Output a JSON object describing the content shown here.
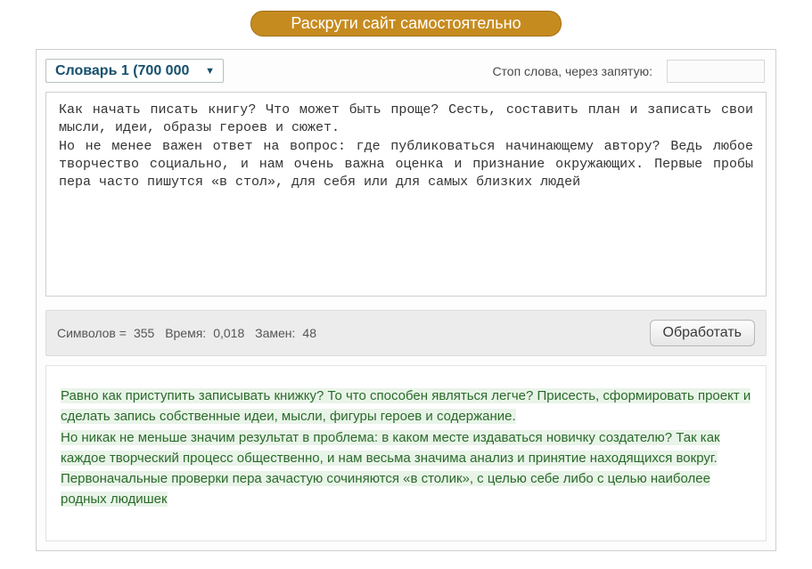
{
  "banner": {
    "text": "Раскрути сайт самостоятельно"
  },
  "controls": {
    "dictionary_selected": "Словарь 1 (700 000",
    "stop_label": "Стоп слова, через запятую:",
    "stop_value": ""
  },
  "input": {
    "value": "Как начать писать книгу? Что может быть проще? Сесть, составить план и записать свои мысли, идеи, образы героев и сюжет.\nНо не менее важен ответ на вопрос: где публиковаться начинающему автору? Ведь любое творчество социально, и нам очень важна оценка и признание окружающих. Первые пробы пера часто пишутся «в стол», для себя или для самых близких людей"
  },
  "stats": {
    "chars_label": "Символов =",
    "chars_value": "355",
    "time_label": "Время:",
    "time_value": "0,018",
    "repl_label": "Замен:",
    "repl_value": "48",
    "process_label": "Обработать"
  },
  "output": {
    "part1": "Равно как приступить записывать книжку? То что способен являться легче? Присесть, сформировать проект и сделать запись собственные идеи, мысли, фигуры героев и содержание.",
    "part2": "Но никак не меньше значим результат в проблема: в каком месте издаваться новичку создателю? Так как каждое творческий процесс общественно, и нам весьма значима анализ и принятие находящихся вокруг. Первоначальные проверки пера зачастую сочиняются «в столик», с целью себе либо с целью наиболее родных людишек"
  }
}
